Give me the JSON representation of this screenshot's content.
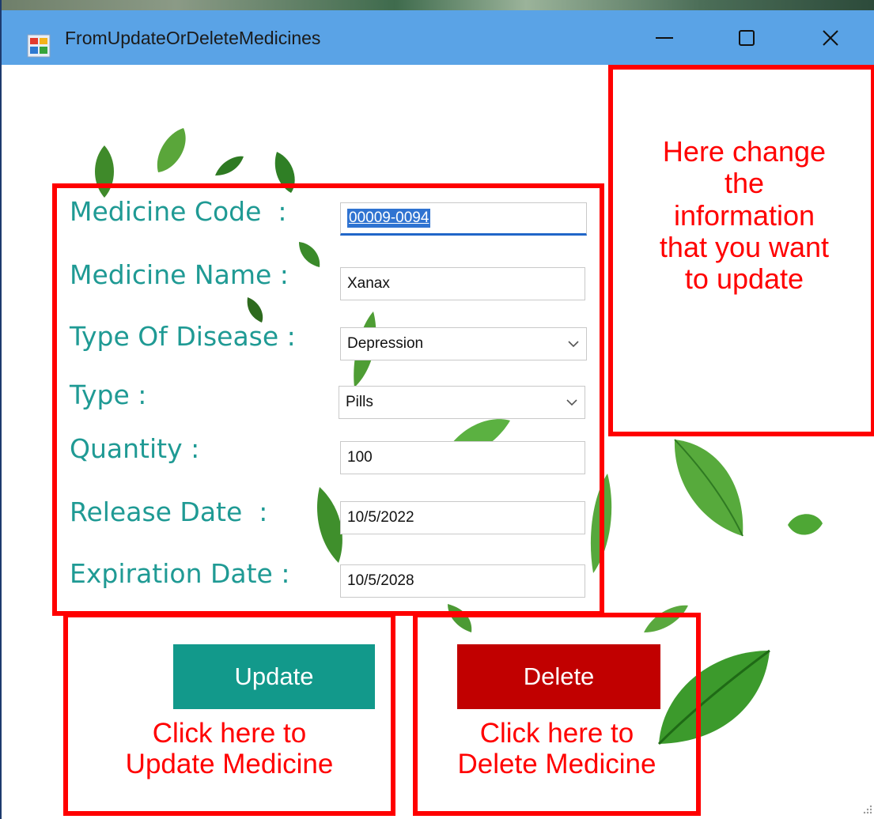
{
  "window": {
    "title": "FromUpdateOrDeleteMedicines"
  },
  "form": {
    "code": {
      "label": "Medicine Code  :",
      "value": "00009-0094"
    },
    "name": {
      "label": "Medicine Name :",
      "value": "Xanax"
    },
    "disease": {
      "label": "Type Of Disease :",
      "value": "Depression"
    },
    "type": {
      "label": "Type :",
      "value": "Pills"
    },
    "quantity": {
      "label": "Quantity :",
      "value": "100"
    },
    "release": {
      "label": "Release Date  :",
      "value": "10/5/2022"
    },
    "expiration": {
      "label": "Expiration Date :",
      "value": "10/5/2028"
    }
  },
  "buttons": {
    "update_label": "Update",
    "delete_label": "Delete"
  },
  "annotations": {
    "info_lines": [
      "Here change",
      "the",
      "information",
      "that you want",
      "to update"
    ],
    "update_lines": [
      "Click here to",
      "Update Medicine"
    ],
    "delete_lines": [
      "Click here to",
      "Delete Medicine"
    ]
  },
  "colors": {
    "titlebar": "#5aa3e6",
    "label_teal": "#1f9a94",
    "update_button": "#12998b",
    "delete_button": "#c10000",
    "annotation_red": "#ff0000"
  },
  "icons": {
    "app": "windows-form-icon",
    "minimize": "minimize-icon",
    "maximize": "maximize-icon",
    "close": "close-icon",
    "dropdown": "chevron-down-icon",
    "decoration": "leaf-icon"
  }
}
